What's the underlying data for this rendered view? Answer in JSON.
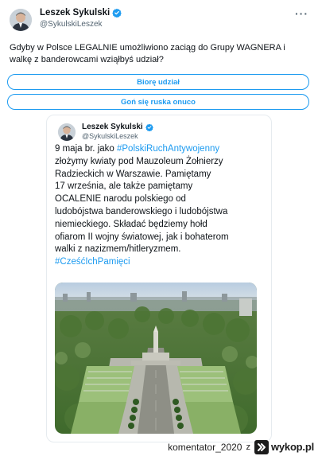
{
  "header": {
    "display_name": "Leszek Sykulski",
    "handle": "@SykulskiLeszek",
    "more_icon": "more-horizontal-icon",
    "verified_icon": "verified-badge-icon"
  },
  "question": "Gdyby w Polsce LEGALNIE umożliwiono zaciąg do Grupy WAGNERA i walkę z banderowcami wziąłbyś udział?",
  "poll": {
    "options": [
      {
        "label": "Biorę udział"
      },
      {
        "label": "Goń się ruska onuco"
      }
    ]
  },
  "quoted": {
    "display_name": "Leszek Sykulski",
    "handle": "@SykulskiLeszek",
    "lines": [
      {
        "pre": "9 maja br. jako ",
        "tag": "#PolskiRuchAntywojenny",
        "post": ""
      },
      {
        "pre": "złożymy kwiaty pod Mauzoleum Żołnierzy",
        "tag": "",
        "post": ""
      },
      {
        "pre": "Radzieckich w Warszawie. Pamiętamy",
        "tag": "",
        "post": ""
      },
      {
        "pre": "17 września, ale także pamiętamy",
        "tag": "",
        "post": ""
      },
      {
        "pre": "OCALENIE narodu polskiego od",
        "tag": "",
        "post": ""
      },
      {
        "pre": "ludobójstwa banderowskiego i ludobójstwa",
        "tag": "",
        "post": ""
      },
      {
        "pre": "niemieckiego. Składać będziemy hołd",
        "tag": "",
        "post": ""
      },
      {
        "pre": "ofiarom II wojny światowej, jak i bohaterom",
        "tag": "",
        "post": ""
      },
      {
        "pre": "walki z nazizmem/hitleryzmem.",
        "tag": "",
        "post": ""
      },
      {
        "pre": "",
        "tag": "#CześćIchPamięci",
        "post": ""
      }
    ]
  },
  "footer": {
    "user": "komentator_2020",
    "separator": "z",
    "site": "wykop.pl"
  },
  "colors": {
    "accent": "#1d9bf0",
    "text": "#0f1419",
    "muted": "#536471"
  }
}
